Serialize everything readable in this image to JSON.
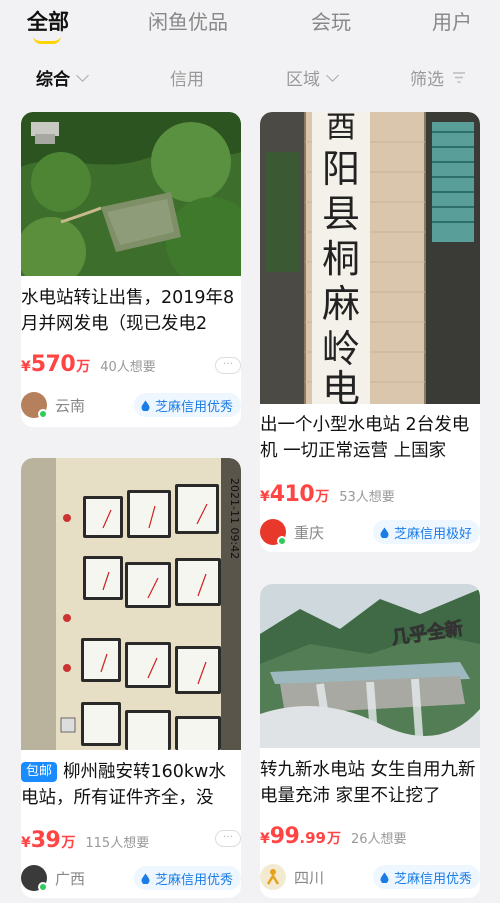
{
  "tabs": {
    "all": "全部",
    "xianyu_select": "闲鱼优品",
    "play": "会玩",
    "users": "用户"
  },
  "filters": {
    "overall": "综合",
    "credit": "信用",
    "region": "区域",
    "filter": "筛选"
  },
  "colors": {
    "accent_yellow": "#ffd400",
    "price_red": "#ff4444",
    "credit_blue": "#1a7ce6",
    "online_green": "#2fcc5a"
  },
  "listings": [
    {
      "title": "水电站转让出售，2019年8月并网发电（现已发电2",
      "price_yen": "¥",
      "price": "570",
      "price_unit": "万",
      "want": "40人想要",
      "region": "云南",
      "credit": "芝麻信用优秀",
      "more": "···"
    },
    {
      "photo_text": "酉阳县桐麻岭电站",
      "title": "出一个小型水电站 2台发电机 一切正常运营 上国家",
      "price_yen": "¥",
      "price": "410",
      "price_unit": "万",
      "want": "53人想要",
      "region": "重庆",
      "credit": "芝麻信用极好"
    },
    {
      "badge": "包邮",
      "photo_text": "2021-11 09:42",
      "title": "柳州融安转160kw水电站，所有证件齐全，没",
      "price_yen": "¥",
      "price": "39",
      "price_unit": "万",
      "want": "115人想要",
      "region": "广西",
      "credit": "芝麻信用优秀",
      "more": "···"
    },
    {
      "photo_text": "几乎全新",
      "title": "转九新水电站 女生自用九新 电量充沛 家里不让挖了",
      "price_yen": "¥",
      "price": "99",
      "price_decimal": ".99",
      "price_unit": "万",
      "want": "26人想要",
      "region": "四川",
      "credit": "芝麻信用优秀"
    }
  ]
}
